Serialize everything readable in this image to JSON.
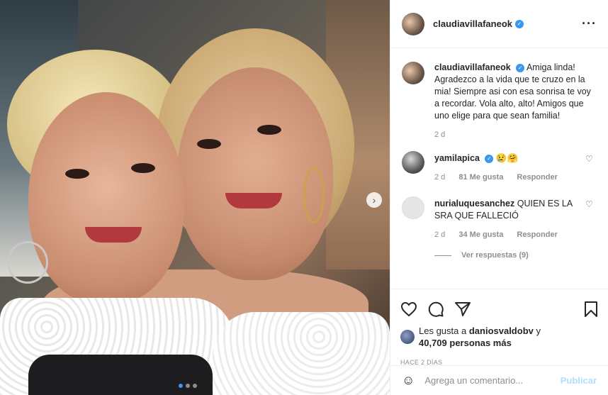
{
  "post": {
    "username": "claudiavillafaneok",
    "more_icon": "more-icon",
    "caption": "Amiga linda! Agradezco a la vida que te cruzo en la mia! Siempre asi con esa sonrisa te voy a recordar. Vola alto, alto! Amigos que uno elige para que sean familia!",
    "caption_age": "2 d"
  },
  "comments": [
    {
      "username": "yamilapica",
      "verified": true,
      "text": "😢🤗",
      "age": "2 d",
      "likes": "81 Me gusta",
      "reply": "Responder"
    },
    {
      "username": "nurialuquesanchez",
      "verified": false,
      "text": "QUIEN ES LA SRA QUE FALLECIÓ",
      "age": "2 d",
      "likes": "34 Me gusta",
      "reply": "Responder",
      "view_replies": "Ver respuestas (9)"
    }
  ],
  "likes_line": {
    "prefix": "Les gusta a",
    "user": "daniosvaldobv",
    "suffix": "y",
    "count": "40,709 personas más"
  },
  "posted_ago": "HACE 2 DÍAS",
  "add_comment": {
    "placeholder": "Agrega un comentario...",
    "publish": "Publicar"
  },
  "colors": {
    "verified": "#3897f0",
    "publish_disabled": "#b2dffc",
    "muted": "#8e8e8e"
  }
}
